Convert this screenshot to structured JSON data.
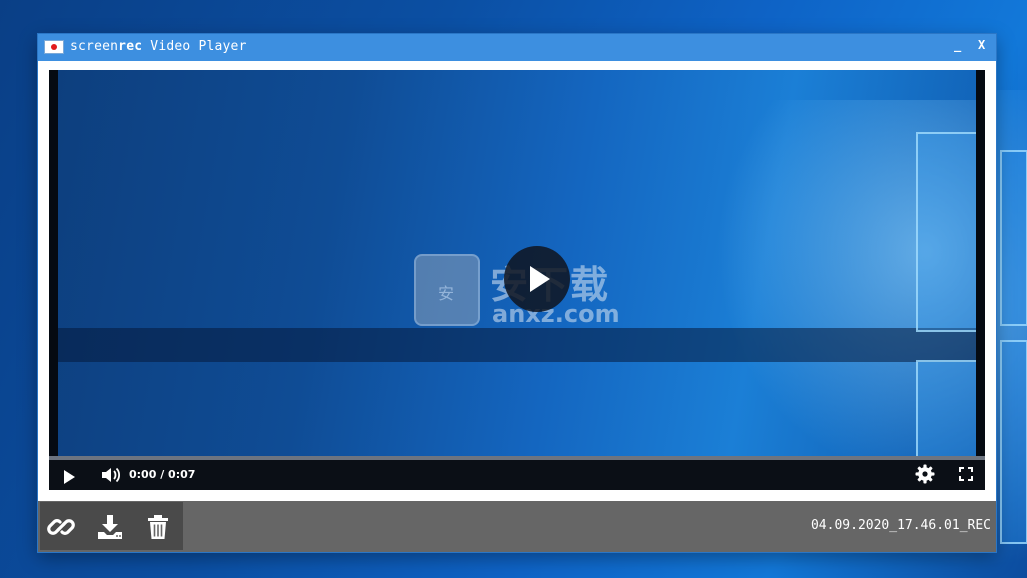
{
  "window": {
    "title_plain": "screen",
    "title_bold": "rec",
    "title_suffix": " Video Player",
    "minimize_label": "_",
    "close_label": "X"
  },
  "player": {
    "time": "0:00 / 0:07",
    "progress": 0,
    "play_icon": "play-icon",
    "volume_icon": "volume-icon",
    "settings_icon": "gear-icon",
    "fullscreen_icon": "fullscreen-icon"
  },
  "watermark": {
    "chinese": "安下载",
    "url": "anxz.com",
    "badge": "安"
  },
  "toolbar": {
    "icons": [
      "link-icon",
      "download-icon",
      "trash-icon"
    ],
    "filename": "04.09.2020_17.46.01_REC"
  },
  "colors": {
    "titlebar": "#3d8fe0",
    "toolbar": "#666666",
    "record_dot": "#e21b1b"
  }
}
